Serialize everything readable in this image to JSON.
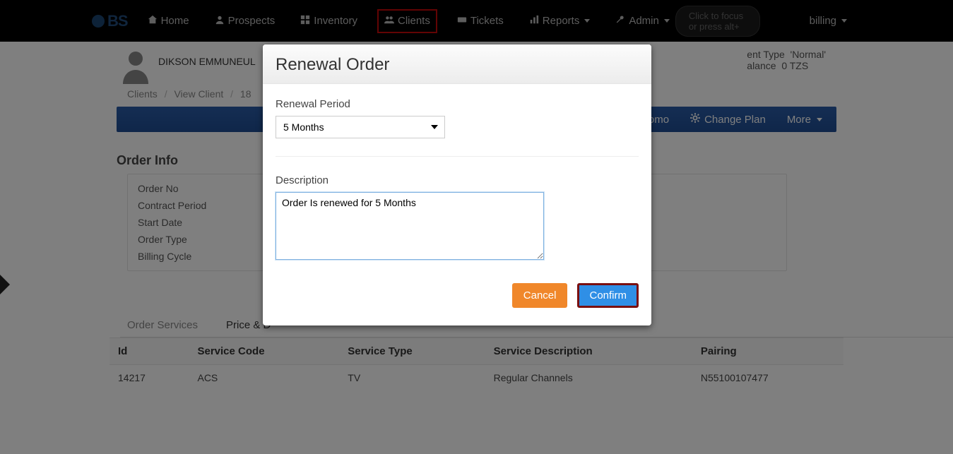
{
  "brand": "BS",
  "nav": {
    "home": "Home",
    "prospects": "Prospects",
    "inventory": "Inventory",
    "clients": "Clients",
    "tickets": "Tickets",
    "reports": "Reports",
    "admin": "Admin"
  },
  "search": {
    "placeholder": "Click to focus or press alt+"
  },
  "user": "billing",
  "client": {
    "name": "DIKSON EMMUNEUL",
    "type_label": "ent Type",
    "type_value": "Normal",
    "balance_label": "alance",
    "balance_value": "0 TZS"
  },
  "breadcrumb": {
    "a": "Clients",
    "b": "View Client",
    "c": "18"
  },
  "bluebar": {
    "promo": "Promo",
    "change_plan": "Change Plan",
    "more": "More"
  },
  "section_order_info_title": "Order Info",
  "order_info": {
    "order_no": "Order No",
    "contract_period": "Contract Period",
    "start_date": "Start Date",
    "order_type": "Order Type",
    "billing_cycle": "Billing Cycle"
  },
  "tabs": {
    "order_services": "Order Services",
    "price_d": "Price & D"
  },
  "table": {
    "headers": {
      "id": "Id",
      "service_code": "Service Code",
      "service_type": "Service Type",
      "service_description": "Service Description",
      "pairing": "Pairing"
    },
    "row": {
      "id": "14217",
      "service_code": "ACS",
      "service_type": "TV",
      "service_description": "Regular Channels",
      "pairing": "N55100107477"
    }
  },
  "modal": {
    "title": "Renewal Order",
    "renewal_period_label": "Renewal Period",
    "renewal_period_value": "5 Months",
    "description_label": "Description",
    "description_value": "Order Is renewed for 5 Months",
    "cancel": "Cancel",
    "confirm": "Confirm"
  }
}
